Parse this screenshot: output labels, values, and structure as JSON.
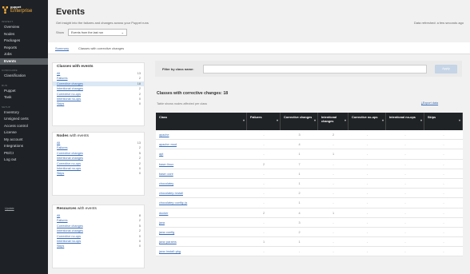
{
  "brand": {
    "line1": "puppet",
    "line2": "Enterprise"
  },
  "sidebar": {
    "sections": [
      {
        "title": "INSPECT",
        "items": [
          "Overview",
          "Nodes",
          "Packages",
          "Reports",
          "Jobs",
          "Events"
        ]
      },
      {
        "title": "CONFIGURE",
        "items": [
          "Classification"
        ]
      },
      {
        "title": "RUN",
        "items": [
          "Puppet",
          "Task"
        ]
      },
      {
        "title": "SETUP",
        "items": [
          "Inventory",
          "Unsigned certs",
          "Access control",
          "License",
          "My account",
          "Integrations",
          "PE/CI",
          "Log out"
        ]
      }
    ],
    "active": "Events",
    "footer": "Update"
  },
  "header": {
    "title": "Events",
    "subtitle": "Get insight into the failures and changes across your Puppet runs",
    "show_label": "Show",
    "show_value": "Events from the last run",
    "refresh": "Data refreshed: a few seconds ago"
  },
  "tabs": [
    "Summary",
    "Classes with corrective changes"
  ],
  "panels": [
    {
      "title": "Classes with events",
      "title_suffix": "",
      "rows": [
        {
          "label": "All",
          "count": "13"
        },
        {
          "label": "Failures",
          "count": "2"
        },
        {
          "label": "Corrective changes",
          "count": "18"
        },
        {
          "label": "Intentional changes",
          "count": "2"
        },
        {
          "label": "Corrective no-ops",
          "count": "2"
        },
        {
          "label": "Intentional no-ops",
          "count": "0"
        },
        {
          "label": "Skips",
          "count": "0"
        }
      ]
    },
    {
      "title": "Nodes",
      "title_suffix": " with events",
      "rows": [
        {
          "label": "All",
          "count": "13"
        },
        {
          "label": "Failures",
          "count": "2"
        },
        {
          "label": "Corrective changes",
          "count": "5"
        },
        {
          "label": "Intentional changes",
          "count": "2"
        },
        {
          "label": "Corrective no-ops",
          "count": "2"
        },
        {
          "label": "Intentional no-ops",
          "count": "0"
        },
        {
          "label": "Skips",
          "count": "0"
        }
      ]
    },
    {
      "title": "Resources",
      "title_suffix": " with events",
      "rows": [
        {
          "label": "All",
          "count": "8"
        },
        {
          "label": "Failures",
          "count": "2"
        },
        {
          "label": "Corrective changes",
          "count": "5"
        },
        {
          "label": "Intentional changes",
          "count": "2"
        },
        {
          "label": "Corrective no-ops",
          "count": "0"
        },
        {
          "label": "Intentional no-ops",
          "count": "0"
        },
        {
          "label": "Skips",
          "count": "0"
        }
      ]
    }
  ],
  "filter": {
    "label": "Filter by class name:",
    "placeholder": "",
    "apply": "Apply"
  },
  "main": {
    "title": "Classes with corrective changes: 18",
    "subtitle": "Table shows nodes affected per class",
    "export": "Export data"
  },
  "table": {
    "columns": [
      "Class",
      "Failures",
      "Corrective changes",
      "Intentional changes",
      "Corrective no-ops",
      "Intentional no-ops",
      "Skips"
    ],
    "rows": [
      [
        "apache",
        "-",
        "3",
        "2",
        "-",
        "-",
        "-"
      ],
      [
        "apache::mod",
        "-",
        "4",
        "-",
        "-",
        "-",
        "-"
      ],
      [
        "apt",
        "-",
        "1",
        "1",
        "-",
        "-",
        "-"
      ],
      [
        "base::linux",
        "2",
        "7",
        "-",
        "-",
        "-",
        "-"
      ],
      [
        "base::core",
        "-",
        "1",
        "-",
        "-",
        "-",
        "-"
      ],
      [
        "chocolatey",
        "-",
        "1",
        "-",
        "-",
        "-",
        "-"
      ],
      [
        "chocolatey::install",
        "-",
        "2",
        "-",
        "-",
        "-",
        "-"
      ],
      [
        "chocolatey::config::js",
        "-",
        "1",
        "-",
        "-",
        "-",
        "-"
      ],
      [
        "docker",
        "2",
        "4",
        "1",
        "-",
        "-",
        "-"
      ],
      [
        "java",
        "-",
        "3",
        "-",
        "-",
        "-",
        "-"
      ],
      [
        "java::config",
        "-",
        "2",
        "-",
        "-",
        "-",
        "-"
      ],
      [
        "java::params",
        "1",
        "1",
        "-",
        "-",
        "-",
        "-"
      ],
      [
        "java::install::pkg",
        "-",
        "-",
        "-",
        "-",
        "-",
        "-"
      ]
    ]
  },
  "colors": {
    "sidebar_bg": "#1e2226",
    "accent": "#fbb03b",
    "link": "#3b6db4",
    "table_head": "#202326"
  }
}
